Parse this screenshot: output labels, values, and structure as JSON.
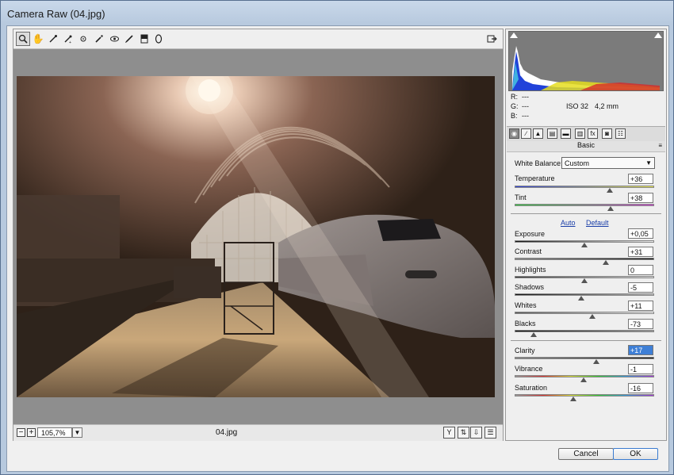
{
  "window": {
    "title": "Camera Raw (04.jpg)"
  },
  "toolbar": {
    "tools": [
      "zoom-icon",
      "hand-icon",
      "white-balance-icon",
      "color-sampler-icon",
      "targeted-adjustment-icon",
      "spot-removal-icon",
      "red-eye-icon",
      "adjustment-brush-icon",
      "graduated-filter-icon",
      "radial-filter-icon"
    ]
  },
  "statusbar": {
    "zoom": "105,7%",
    "filename": "04.jpg",
    "zoom_out": "−",
    "zoom_in": "+"
  },
  "readout": {
    "r_label": "R:",
    "g_label": "G:",
    "b_label": "B:",
    "r": "---",
    "g": "---",
    "b": "---",
    "iso": "ISO 32",
    "focal": "4,2 mm"
  },
  "panel": {
    "title": "Basic",
    "menu_glyph": "≡"
  },
  "white_balance": {
    "label": "White Balance:",
    "value": "Custom"
  },
  "controls": {
    "temperature": {
      "label": "Temperature",
      "value": "+36",
      "level": 0.68
    },
    "tint": {
      "label": "Tint",
      "value": "+38",
      "level": 0.69
    },
    "auto_label": "Auto",
    "default_label": "Default",
    "exposure": {
      "label": "Exposure",
      "value": "+0,05",
      "level": 0.5
    },
    "contrast": {
      "label": "Contrast",
      "value": "+31",
      "level": 0.655
    },
    "highlights": {
      "label": "Highlights",
      "value": "0",
      "level": 0.5
    },
    "shadows": {
      "label": "Shadows",
      "value": "-5",
      "level": 0.475
    },
    "whites": {
      "label": "Whites",
      "value": "+11",
      "level": 0.555
    },
    "blacks": {
      "label": "Blacks",
      "value": "-73",
      "level": 0.135
    },
    "clarity": {
      "label": "Clarity",
      "value": "+17",
      "level": 0.585
    },
    "vibrance": {
      "label": "Vibrance",
      "value": "-1",
      "level": 0.495
    },
    "saturation": {
      "label": "Saturation",
      "value": "-16",
      "level": 0.42
    }
  },
  "buttons": {
    "cancel": "Cancel",
    "ok": "OK"
  },
  "colors": {
    "accent": "#3a7bd0",
    "selection": "#3e7fd6"
  }
}
